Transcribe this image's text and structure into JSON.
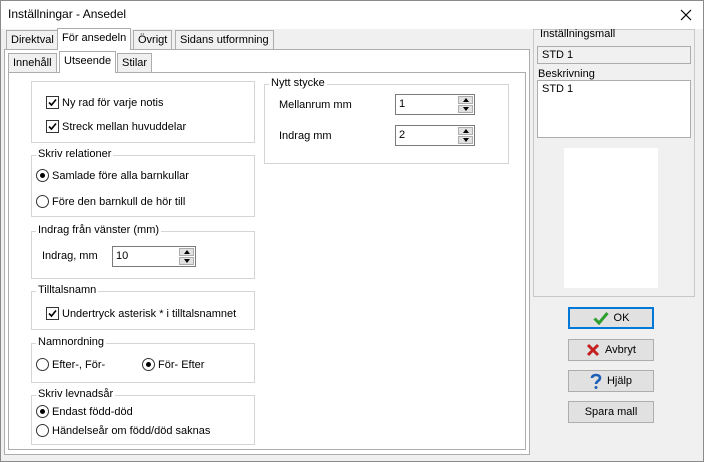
{
  "window": {
    "title": "Inställningar - Ansedel"
  },
  "tabs": [
    "Direktval",
    "För ansedeln",
    "Övrigt",
    "Sidans utformning"
  ],
  "subtabs": [
    "Innehåll",
    "Utseende",
    "Stilar"
  ],
  "general": {
    "new_line_per_note": "Ny rad för varje notis",
    "line_between_sections": "Streck mellan huvuddelar"
  },
  "relations": {
    "title": "Skriv relationer",
    "opt1": "Samlade före alla barnkullar",
    "opt2": "Före den barnkull de hör till"
  },
  "indent_left": {
    "title": "Indrag från vänster (mm)",
    "label": "Indrag, mm",
    "value": "10"
  },
  "nickname": {
    "title": "Tilltalsnamn",
    "suppress": "Undertryck asterisk * i tilltalsnamnet"
  },
  "name_order": {
    "title": "Namnordning",
    "opt1": "Efter-, För-",
    "opt2": "För- Efter"
  },
  "lifespan": {
    "title": "Skriv levnadsår",
    "opt1": "Endast född-död",
    "opt2": "Händelseår om född/död saknas"
  },
  "new_paragraph": {
    "title": "Nytt stycke",
    "spacing_label": "Mellanrum mm",
    "spacing_value": "1",
    "indent_label": "Indrag mm",
    "indent_value": "2"
  },
  "template": {
    "label": "Inställningsmall",
    "value": "STD 1",
    "desc_label": "Beskrivning",
    "desc_value": "STD 1"
  },
  "buttons": {
    "ok": "OK",
    "cancel": "Avbryt",
    "help": "Hjälp",
    "save": "Spara mall"
  }
}
